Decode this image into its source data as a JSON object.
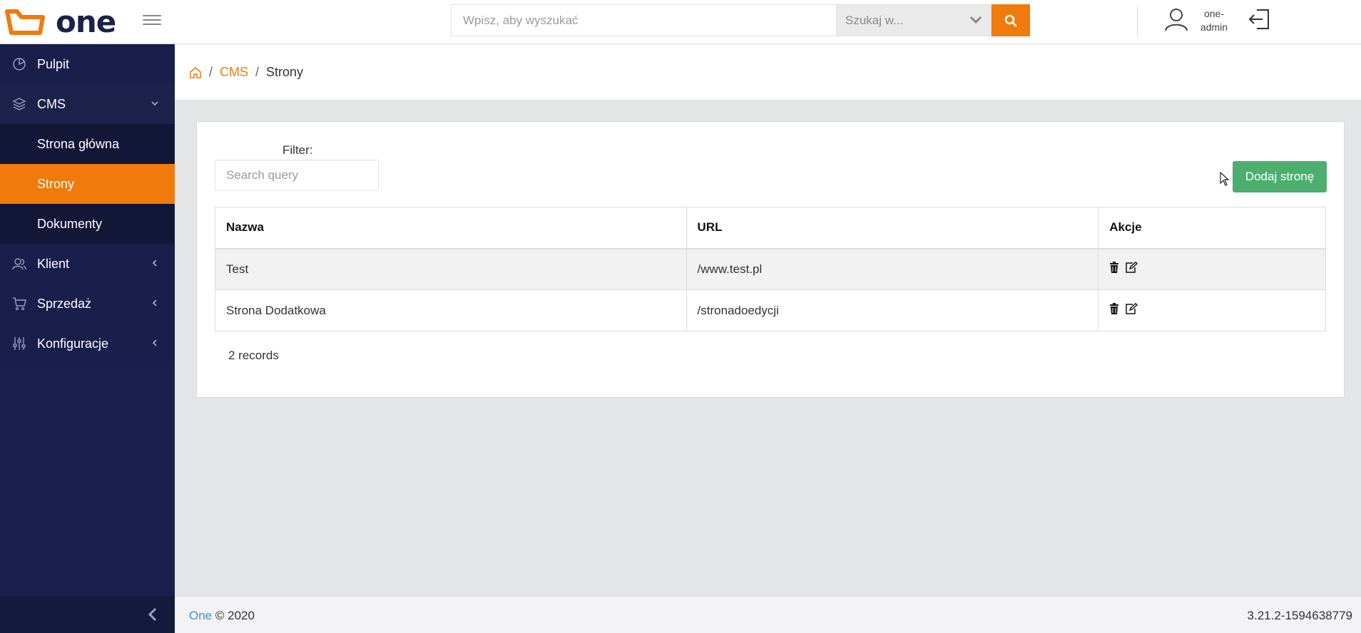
{
  "header": {
    "logo_text": "one",
    "search": {
      "placeholder": "Wpisz, aby wyszukać",
      "scope_placeholder": "Szukaj w..."
    },
    "user": {
      "name_line1": "one-",
      "name_line2": "admin"
    },
    "accent_color": "#f07a0c"
  },
  "sidebar": {
    "items": [
      {
        "label": "Pulpit",
        "icon": "dashboard-icon"
      },
      {
        "label": "CMS",
        "icon": "layers-icon",
        "expanded": true,
        "children": [
          {
            "label": "Strona główna"
          },
          {
            "label": "Strony",
            "active": true
          },
          {
            "label": "Dokumenty"
          }
        ]
      },
      {
        "label": "Klient",
        "icon": "users-icon"
      },
      {
        "label": "Sprzedaż",
        "icon": "cart-icon"
      },
      {
        "label": "Konfiguracje",
        "icon": "sliders-icon"
      }
    ],
    "background": "#1a1f4d"
  },
  "breadcrumb": {
    "parent": "CMS",
    "current": "Strony"
  },
  "content": {
    "filter_label": "Filter:",
    "filter_placeholder": "Search query",
    "add_button": "Dodaj stronę",
    "table": {
      "columns": [
        "Nazwa",
        "URL",
        "Akcje"
      ],
      "rows": [
        {
          "name": "Test",
          "url": "/www.test.pl"
        },
        {
          "name": "Strona Dodatkowa",
          "url": "/stronadoedycji"
        }
      ]
    },
    "records": "2 records"
  },
  "footer": {
    "brand": "One",
    "copyright": "© 2020",
    "version": "3.21.2-1594638779"
  }
}
